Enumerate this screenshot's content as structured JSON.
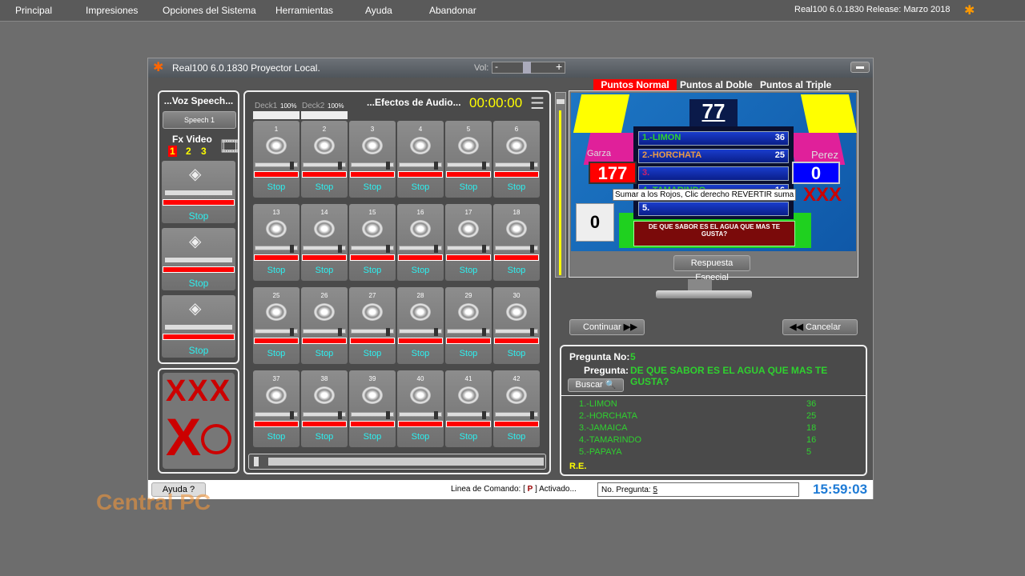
{
  "menu": [
    "Principal",
    "Impresiones",
    "Opciones del Sistema",
    "Herramientas",
    "Ayuda",
    "Abandonar"
  ],
  "release": "Real100 6.0.1830 Release: Marzo 2018",
  "window": {
    "title": "Real100 6.0.1830 Proyector Local.",
    "vol_label": "Vol:",
    "vol_minus": "-",
    "vol_plus": "+"
  },
  "speech": {
    "header": "...Voz Speech...",
    "button": "Speech 1",
    "fx_label": "Fx Video",
    "fx_nums": [
      "1",
      "2",
      "3"
    ],
    "stop": "Stop",
    "xxx": "XXX",
    "x": "X"
  },
  "audio": {
    "deck1": "Deck1",
    "deck1_pct": "100%",
    "deck2": "Deck2",
    "deck2_pct": "100%",
    "title": "...Efectos de Audio...",
    "timer": "00:00:00",
    "stop": "Stop",
    "pads": [
      [
        "1",
        "2",
        "3",
        "4",
        "5",
        "6"
      ],
      [
        "13",
        "14",
        "15",
        "16",
        "17",
        "18"
      ],
      [
        "25",
        "26",
        "27",
        "28",
        "29",
        "30"
      ],
      [
        "37",
        "38",
        "39",
        "40",
        "41",
        "42"
      ]
    ]
  },
  "board": {
    "tabs": [
      "Puntos Normal",
      "Puntos al Doble",
      "Puntos al Triple"
    ],
    "active_tab": 0,
    "total": "77",
    "team_left": "Garza",
    "score_left": "177",
    "team_right": "Perez",
    "score_right": "0",
    "strikes": "XXX",
    "timer": "0",
    "answers": [
      {
        "label": "1.-LIMON",
        "value": "36",
        "color": "#2fd12f"
      },
      {
        "label": "2.-HORCHATA",
        "value": "25",
        "color": "#e89a4a"
      },
      {
        "label": "3.",
        "value": "",
        "color": "#d0206a"
      },
      {
        "label": "4.-TAMARINDO",
        "value": "16",
        "color": "#2fd12f"
      },
      {
        "label": "5.",
        "value": "",
        "color": "#ffffff"
      }
    ],
    "question": "DE QUE SABOR ES EL AGUA QUE MAS TE GUSTA?",
    "tooltip": "Sumar a los Rojos, Clic derecho REVERTIR suma",
    "special_button": "Respuesta Especial"
  },
  "nav": {
    "continue": "Continuar",
    "cancel": "Cancelar"
  },
  "qpanel": {
    "num_label": "Pregunta No:",
    "num": "5",
    "q_label": "Pregunta:",
    "question": "DE QUE SABOR ES EL AGUA QUE MAS TE GUSTA?",
    "search": "Buscar",
    "answers": [
      {
        "a": "1.-LIMON",
        "v": "36"
      },
      {
        "a": "2.-HORCHATA",
        "v": "25"
      },
      {
        "a": "3.-JAMAICA",
        "v": "18"
      },
      {
        "a": "4.-TAMARINDO",
        "v": "16"
      },
      {
        "a": "5.-PAPAYA",
        "v": "5"
      }
    ],
    "re": "R.E."
  },
  "status": {
    "help": "Ayuda",
    "cmd": "Linea de Comando: [",
    "cmd_key": "P",
    "cmd_end": "] Activado...",
    "qno_label": "No. Pregunta:",
    "qno": "5",
    "clock": "15:59:03"
  },
  "colors": {
    "accent_red": "#ff0000",
    "cyan": "#2cf0f0",
    "green": "#2fd12f",
    "clock": "#1e7bd6"
  },
  "watermark": "Central PC"
}
